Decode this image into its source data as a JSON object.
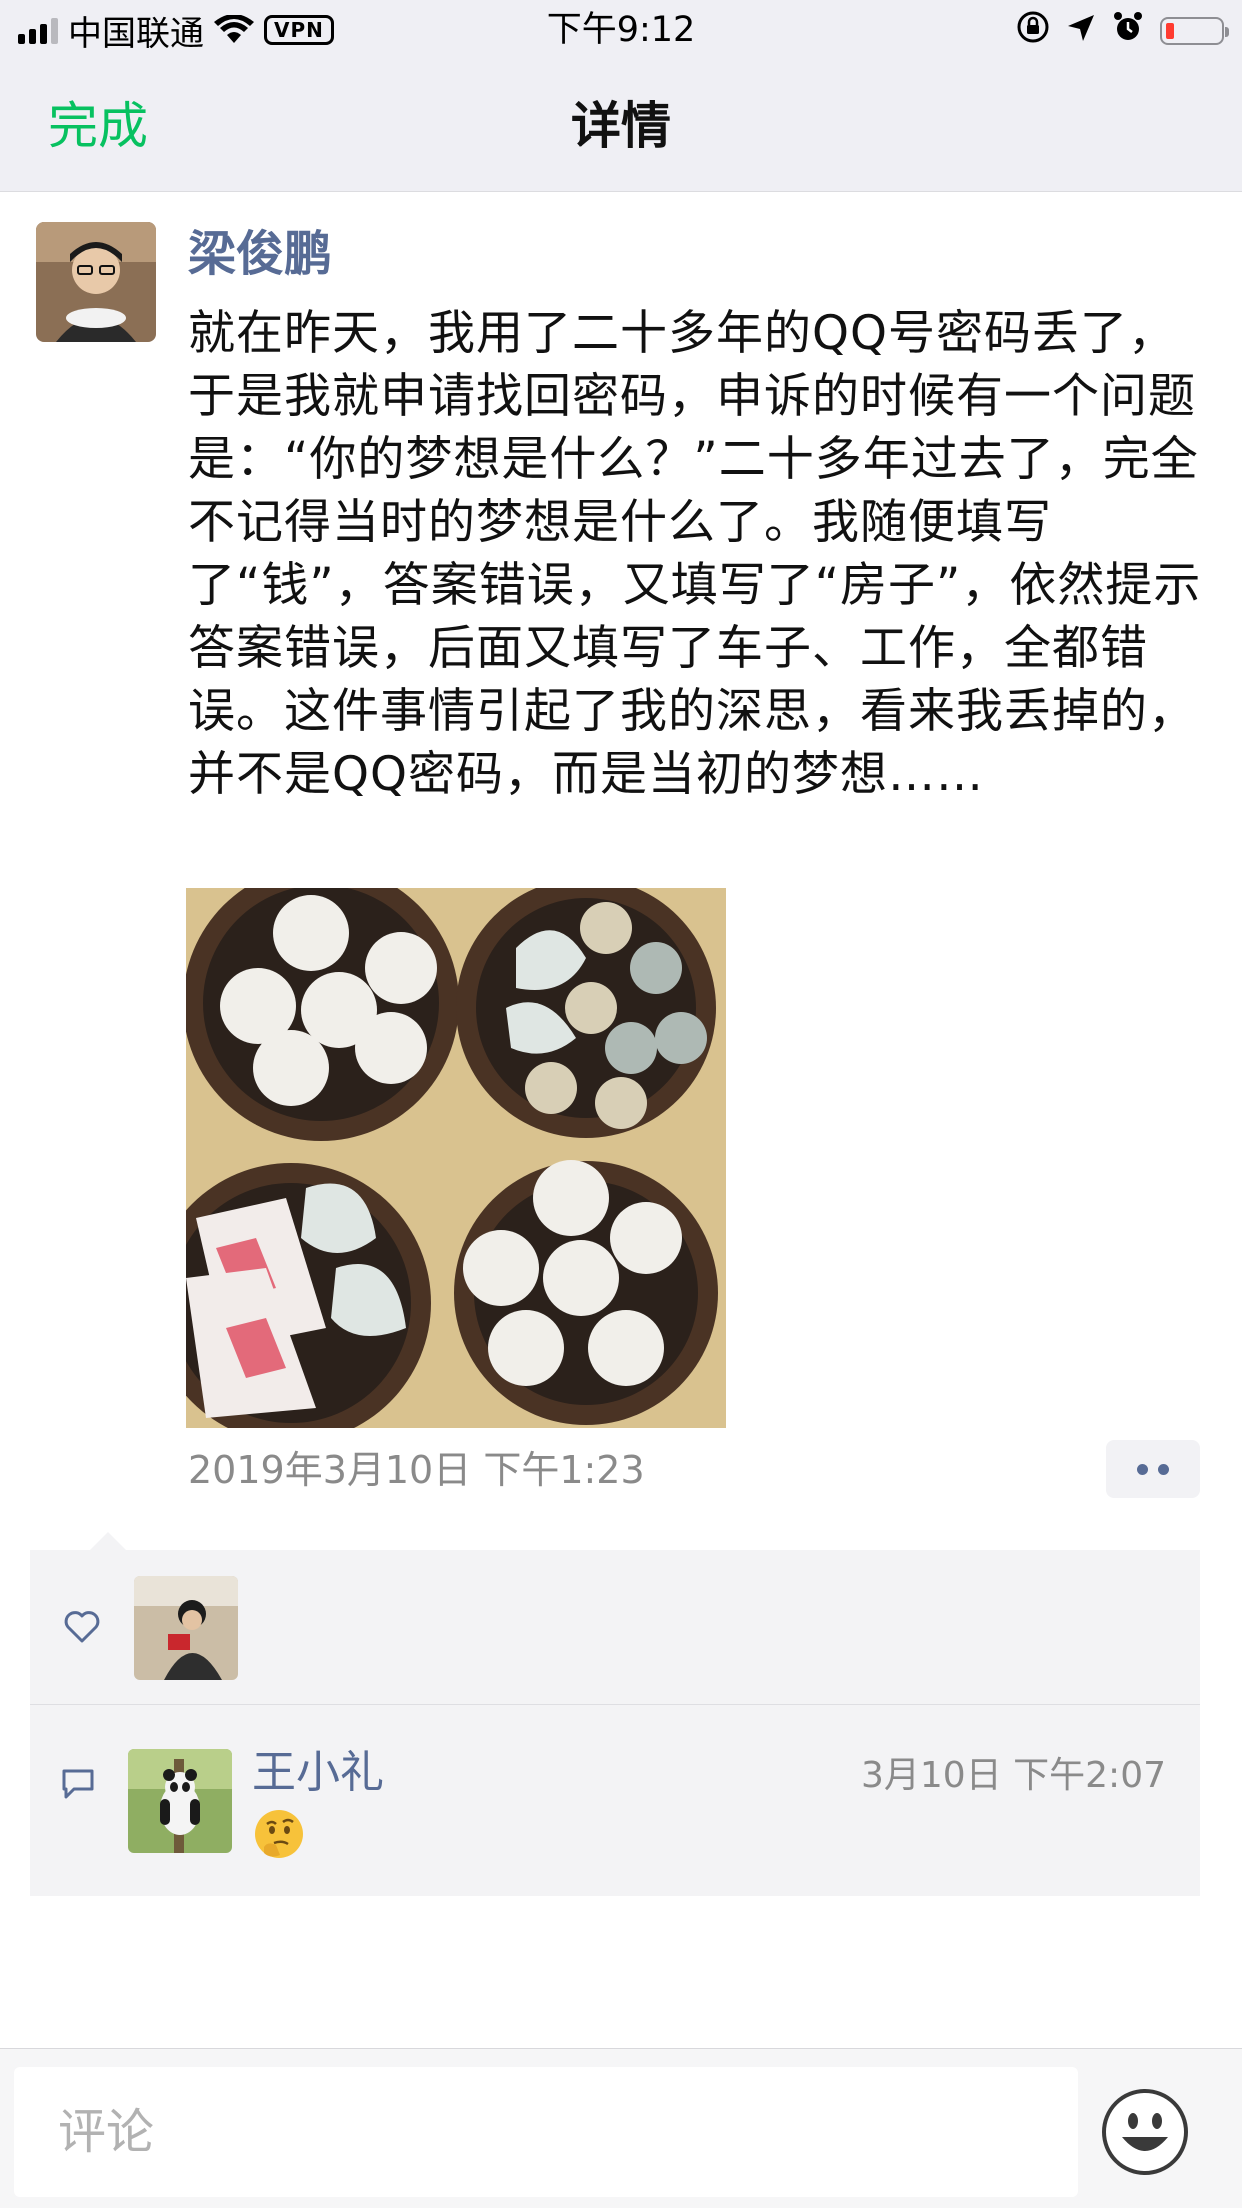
{
  "status_bar": {
    "carrier": "中国联通",
    "vpn": "VPN",
    "time": "下午9:12"
  },
  "nav": {
    "done_label": "完成",
    "title": "详情"
  },
  "post": {
    "author": "梁俊鹏",
    "text": "就在昨天，我用了二十多年的QQ号密码丢了，于是我就申请找回密码，申诉的时候有一个问题是：“你的梦想是什么？”二十多年过去了，完全不记得当时的梦想是什么了。我随便填写了“钱”，答案错误，又填写了“房子”，依然提示答案错误，后面又填写了车子、工作，全都错误。这件事情引起了我的深思，看来我丢掉的，并不是QQ密码，而是当初的梦想……",
    "timestamp": "2019年3月10日 下午1:23"
  },
  "comments": [
    {
      "author": "王小礼",
      "time": "3月10日 下午2:07",
      "emoji": "thinking-face"
    }
  ],
  "input": {
    "placeholder": "评论"
  },
  "colors": {
    "accent_green": "#07c160",
    "name_blue": "#576b95",
    "battery_red": "#ff3b30"
  }
}
